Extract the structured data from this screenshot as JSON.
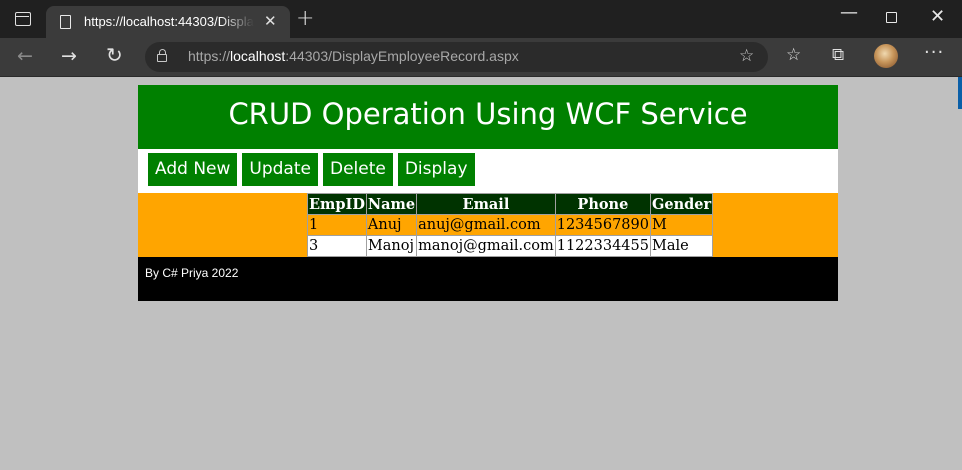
{
  "browser": {
    "tab_title": "https://localhost:44303/DisplayEmployeeRecord.aspx",
    "address_prefix": "https://",
    "address_host": "localhost",
    "address_rest": ":44303/DisplayEmployeeRecord.aspx"
  },
  "page": {
    "title": "CRUD Operation Using WCF Service",
    "menu": [
      "Add New",
      "Update",
      "Delete",
      "Display"
    ],
    "table": {
      "headers": [
        "EmpID",
        "Name",
        "Email",
        "Phone",
        "Gender"
      ],
      "rows": [
        [
          "1",
          "Anuj",
          "anuj@gmail.com",
          "1234567890",
          "M"
        ],
        [
          "3",
          "Manoj",
          "manoj@gmail.com",
          "1122334455",
          "Male"
        ]
      ]
    },
    "footer": "By C# Priya 2022"
  },
  "colors": {
    "header_bg": "#008000",
    "content_bg": "#ffa500",
    "table_header_bg": "#003300",
    "footer_bg": "#000000",
    "page_bg": "#c0c0c0"
  }
}
